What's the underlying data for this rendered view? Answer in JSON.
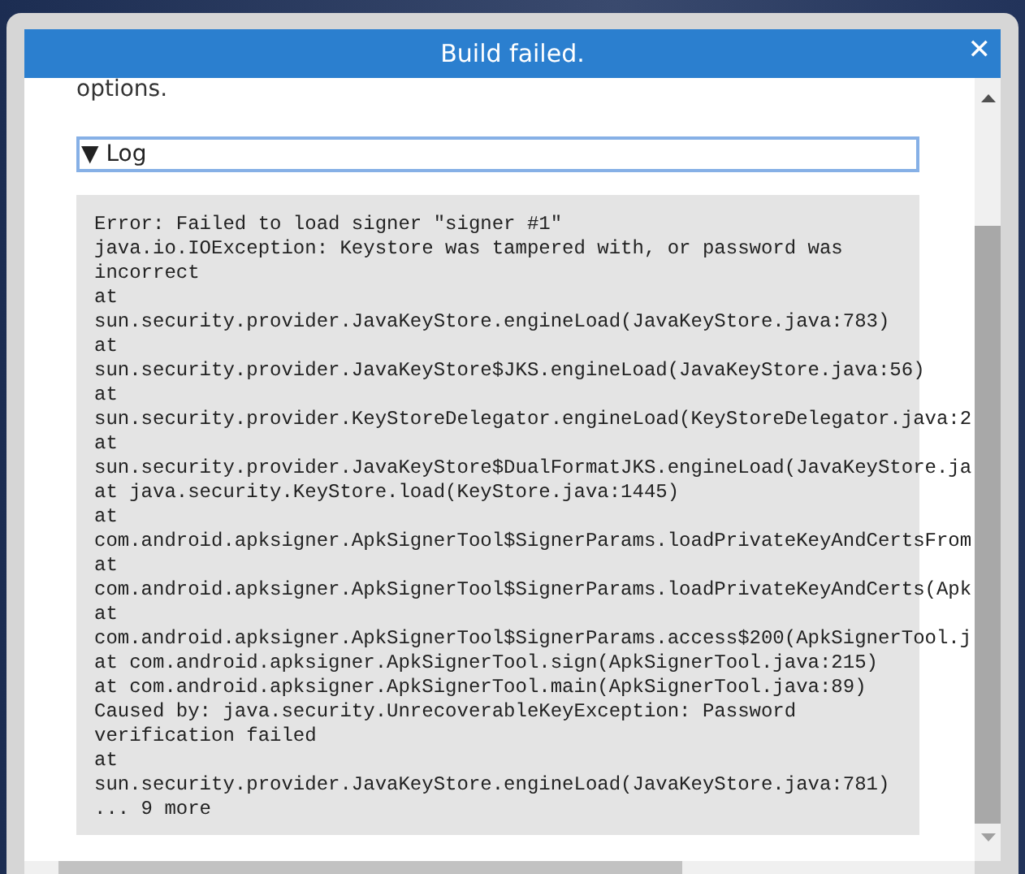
{
  "window": {
    "title": "Build failed.",
    "close": "✕"
  },
  "intro_text": "options.",
  "log_section": {
    "marker": "▼",
    "label": "Log",
    "lines": [
      "Error: Failed to load signer \"signer #1\"",
      "java.io.IOException: Keystore was tampered with, or password was",
      "incorrect",
      "at",
      "sun.security.provider.JavaKeyStore.engineLoad(JavaKeyStore.java:783)",
      "at",
      "sun.security.provider.JavaKeyStore$JKS.engineLoad(JavaKeyStore.java:56)",
      "at",
      "sun.security.provider.KeyStoreDelegator.engineLoad(KeyStoreDelegator.java:2",
      "at",
      "sun.security.provider.JavaKeyStore$DualFormatJKS.engineLoad(JavaKeyStore.ja",
      "at java.security.KeyStore.load(KeyStore.java:1445)",
      "at",
      "com.android.apksigner.ApkSignerTool$SignerParams.loadPrivateKeyAndCertsFrom",
      "at",
      "com.android.apksigner.ApkSignerTool$SignerParams.loadPrivateKeyAndCerts(Apk",
      "at",
      "com.android.apksigner.ApkSignerTool$SignerParams.access$200(ApkSignerTool.j",
      "at com.android.apksigner.ApkSignerTool.sign(ApkSignerTool.java:215)",
      "at com.android.apksigner.ApkSignerTool.main(ApkSignerTool.java:89)",
      "Caused by: java.security.UnrecoverableKeyException: Password",
      "verification failed",
      "at",
      "sun.security.provider.JavaKeyStore.engineLoad(JavaKeyStore.java:781)",
      "... 9 more"
    ]
  }
}
